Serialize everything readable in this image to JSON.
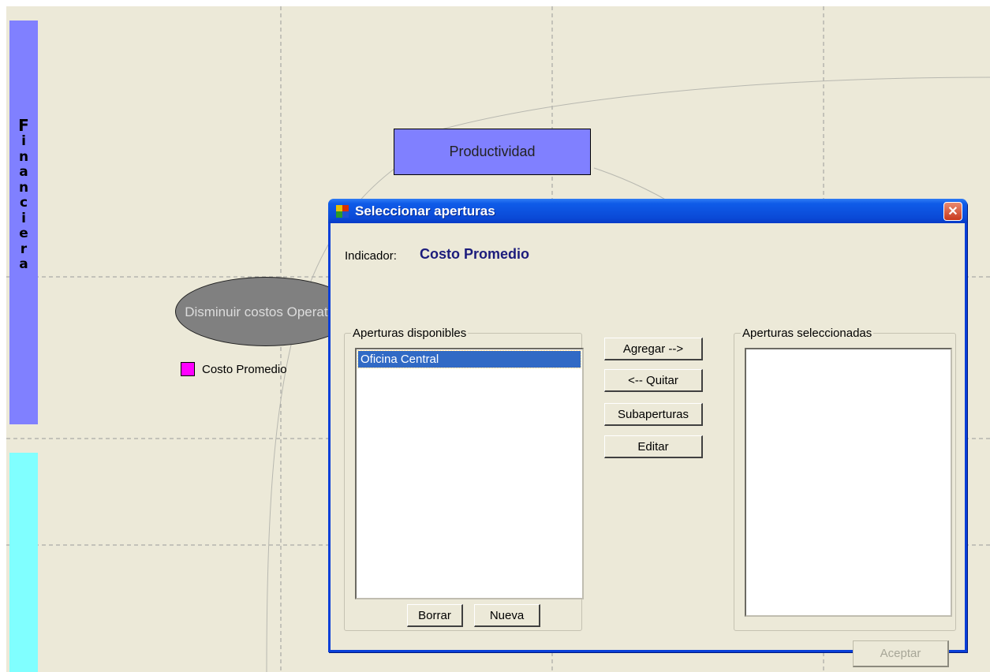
{
  "diagram": {
    "perspectives": [
      {
        "letters": [
          "F",
          "i",
          "n",
          "a",
          "n",
          "c",
          "i",
          "e",
          "r",
          "a"
        ],
        "color": "#8080ff"
      },
      {
        "letters": [],
        "color": "#80ffff"
      }
    ],
    "objective_box": {
      "label": "Productividad",
      "color": "#8080ff"
    },
    "objective_ellipse": {
      "label": "Disminuir costos Operativos",
      "color": "#808080"
    },
    "legend_item": {
      "label": "Costo Promedio",
      "color": "#ff00ff"
    }
  },
  "dialog": {
    "title": "Seleccionar aperturas",
    "close_symbol": "✕",
    "indicator_label": "Indicador:",
    "indicator_value": "Costo Promedio",
    "available": {
      "title": "Aperturas disponibles",
      "items": [
        {
          "label": "Oficina Central",
          "selected": true
        }
      ],
      "delete_label": "Borrar",
      "new_label": "Nueva"
    },
    "actions": {
      "add_label": "Agregar -->",
      "remove_label": "<-- Quitar",
      "sub_label": "Subaperturas",
      "edit_label": "Editar"
    },
    "selected": {
      "title": "Aperturas seleccionadas",
      "items": []
    },
    "accept_label": "Aceptar",
    "accept_enabled": false
  }
}
